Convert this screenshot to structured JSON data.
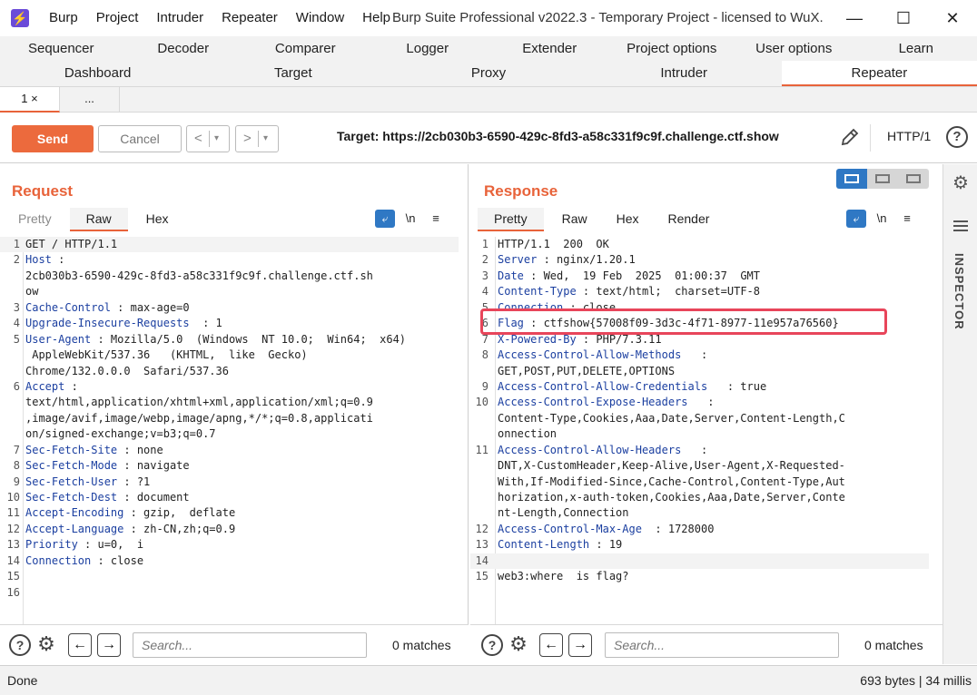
{
  "titlebar": {
    "logo": "⚡",
    "menu": [
      "Burp",
      "Project",
      "Intruder",
      "Repeater",
      "Window",
      "Help"
    ],
    "title": "Burp Suite Professional v2022.3 - Temporary Project - licensed to WuX.",
    "controls": {
      "minimize": "—",
      "maximize": "☐",
      "close": "✕"
    }
  },
  "tabs_row1": [
    "Sequencer",
    "Decoder",
    "Comparer",
    "Logger",
    "Extender",
    "Project options",
    "User options",
    "Learn"
  ],
  "tabs_row2": [
    "Dashboard",
    "Target",
    "Proxy",
    "Intruder",
    "Repeater"
  ],
  "active_tab": "Repeater",
  "subtabs": {
    "first": "1 ×",
    "more": "..."
  },
  "toolbar": {
    "send_label": "Send",
    "cancel_label": "Cancel",
    "back_label": "<",
    "forward_label": ">",
    "dropdown": "▾",
    "target": "Target: https://2cb030b3-6590-429c-8fd3-a58c331f9c9f.challenge.ctf.show",
    "http_version": "HTTP/1",
    "help": "?"
  },
  "request": {
    "title": "Request",
    "tabs": [
      "Pretty",
      "Raw",
      "Hex"
    ],
    "active_tab": "Raw",
    "icon_newline": "\\n",
    "icon_menu": "≡",
    "lines": [
      {
        "n": "1",
        "key": "",
        "val": "GET / HTTP/1.1",
        "hl": true
      },
      {
        "n": "2",
        "key": "Host",
        "val": " :",
        "hl": false
      },
      {
        "n": "",
        "key": "",
        "val": "2cb030b3-6590-429c-8fd3-a58c331f9c9f.challenge.ctf.sh",
        "hl": false
      },
      {
        "n": "",
        "key": "",
        "val": "ow",
        "hl": false
      },
      {
        "n": "3",
        "key": "Cache-Control",
        "val": " : max-age=0",
        "hl": false
      },
      {
        "n": "4",
        "key": "Upgrade-Insecure-Requests",
        "val": "  : 1",
        "hl": false
      },
      {
        "n": "5",
        "key": "User-Agent",
        "val": " : Mozilla/5.0  (Windows  NT 10.0;  Win64;  x64)",
        "hl": false
      },
      {
        "n": "",
        "key": "",
        "val": " AppleWebKit/537.36   (KHTML,  like  Gecko)",
        "hl": false
      },
      {
        "n": "",
        "key": "",
        "val": "Chrome/132.0.0.0  Safari/537.36",
        "hl": false
      },
      {
        "n": "6",
        "key": "Accept",
        "val": " :",
        "hl": false
      },
      {
        "n": "",
        "key": "",
        "val": "text/html,application/xhtml+xml,application/xml;q=0.9",
        "hl": false
      },
      {
        "n": "",
        "key": "",
        "val": ",image/avif,image/webp,image/apng,*/*;q=0.8,applicati",
        "hl": false
      },
      {
        "n": "",
        "key": "",
        "val": "on/signed-exchange;v=b3;q=0.7",
        "hl": false
      },
      {
        "n": "7",
        "key": "Sec-Fetch-Site",
        "val": " : none",
        "hl": false
      },
      {
        "n": "8",
        "key": "Sec-Fetch-Mode",
        "val": " : navigate",
        "hl": false
      },
      {
        "n": "9",
        "key": "Sec-Fetch-User",
        "val": " : ?1",
        "hl": false
      },
      {
        "n": "10",
        "key": "Sec-Fetch-Dest",
        "val": " : document",
        "hl": false
      },
      {
        "n": "11",
        "key": "Accept-Encoding",
        "val": " : gzip,  deflate",
        "hl": false
      },
      {
        "n": "12",
        "key": "Accept-Language",
        "val": " : zh-CN,zh;q=0.9",
        "hl": false
      },
      {
        "n": "13",
        "key": "Priority",
        "val": " : u=0,  i",
        "hl": false
      },
      {
        "n": "14",
        "key": "Connection",
        "val": " : close",
        "hl": false
      },
      {
        "n": "15",
        "key": "",
        "val": "",
        "hl": false
      },
      {
        "n": "16",
        "key": "",
        "val": "",
        "hl": false
      }
    ],
    "search_placeholder": "Search...",
    "matches": "0 matches"
  },
  "response": {
    "title": "Response",
    "tabs": [
      "Pretty",
      "Raw",
      "Hex",
      "Render"
    ],
    "active_tab": "Pretty",
    "icon_newline": "\\n",
    "icon_menu": "≡",
    "lines": [
      {
        "n": "1",
        "key": "",
        "val": "HTTP/1.1  200  OK",
        "hl": false
      },
      {
        "n": "2",
        "key": "Server",
        "val": " : nginx/1.20.1",
        "hl": false
      },
      {
        "n": "3",
        "key": "Date",
        "val": " : Wed,  19 Feb  2025  01:00:37  GMT",
        "hl": false
      },
      {
        "n": "4",
        "key": "Content-Type",
        "val": " : text/html;  charset=UTF-8",
        "hl": false
      },
      {
        "n": "5",
        "key": "Connection",
        "val": " : close",
        "hl": false
      },
      {
        "n": "6",
        "key": "Flag",
        "val": " : ctfshow{57008f09-3d3c-4f71-8977-11e957a76560}",
        "hl": false
      },
      {
        "n": "7",
        "key": "X-Powered-By",
        "val": " : PHP/7.3.11",
        "hl": false
      },
      {
        "n": "8",
        "key": "Access-Control-Allow-Methods",
        "val": "   :",
        "hl": false
      },
      {
        "n": "",
        "key": "",
        "val": "GET,POST,PUT,DELETE,OPTIONS",
        "hl": false
      },
      {
        "n": "9",
        "key": "Access-Control-Allow-Credentials",
        "val": "   : true",
        "hl": false
      },
      {
        "n": "10",
        "key": "Access-Control-Expose-Headers",
        "val": "   :",
        "hl": false
      },
      {
        "n": "",
        "key": "",
        "val": "Content-Type,Cookies,Aaa,Date,Server,Content-Length,C",
        "hl": false
      },
      {
        "n": "",
        "key": "",
        "val": "onnection",
        "hl": false
      },
      {
        "n": "11",
        "key": "Access-Control-Allow-Headers",
        "val": "   :",
        "hl": false
      },
      {
        "n": "",
        "key": "",
        "val": "DNT,X-CustomHeader,Keep-Alive,User-Agent,X-Requested-",
        "hl": false
      },
      {
        "n": "",
        "key": "",
        "val": "With,If-Modified-Since,Cache-Control,Content-Type,Aut",
        "hl": false
      },
      {
        "n": "",
        "key": "",
        "val": "horization,x-auth-token,Cookies,Aaa,Date,Server,Conte",
        "hl": false
      },
      {
        "n": "",
        "key": "",
        "val": "nt-Length,Connection",
        "hl": false
      },
      {
        "n": "12",
        "key": "Access-Control-Max-Age",
        "val": "  : 1728000",
        "hl": false
      },
      {
        "n": "13",
        "key": "Content-Length",
        "val": " : 19",
        "hl": false
      },
      {
        "n": "14",
        "key": "",
        "val": "",
        "hl": true
      },
      {
        "n": "15",
        "key": "",
        "val": "web3:where  is flag?",
        "hl": false
      }
    ],
    "search_placeholder": "Search...",
    "matches": "0 matches"
  },
  "inspector": {
    "label": "INSPECTOR"
  },
  "statusbar": {
    "left": "Done",
    "right": "693 bytes | 34 millis"
  },
  "colors": {
    "accent": "#e8633a",
    "send": "#ec6a3d",
    "key": "#1b3fa0",
    "flag_box": "#e8455a",
    "toggle_blue": "#2f78c4"
  }
}
